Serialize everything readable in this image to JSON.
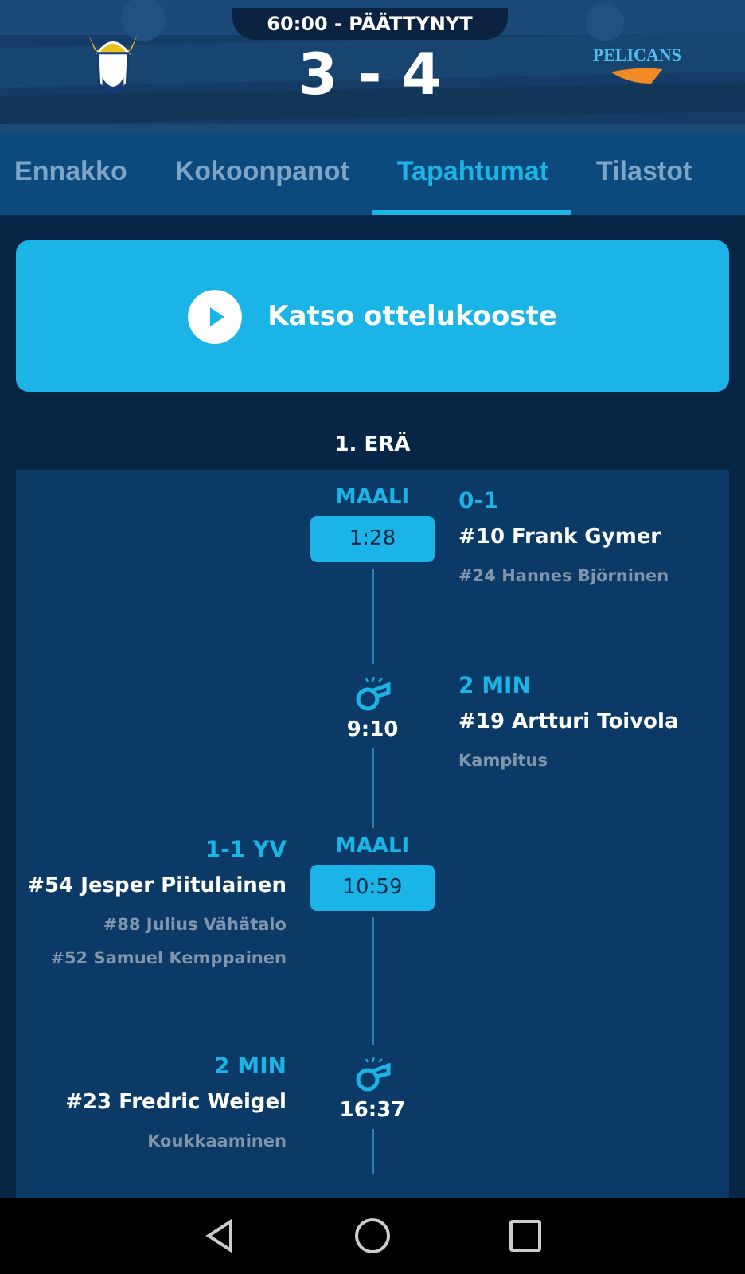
{
  "header": {
    "status": "60:00 - PÄÄTTYNYT",
    "score": "3 - 4",
    "away_logo_text": "PELICANS"
  },
  "tabs": [
    {
      "label": "Ennakko",
      "selected": false
    },
    {
      "label": "Kokoonpanot",
      "selected": false
    },
    {
      "label": "Tapahtumat",
      "selected": true
    },
    {
      "label": "Tilastot",
      "selected": false
    }
  ],
  "highlights_button": {
    "label": "Katso ottelukooste"
  },
  "period": {
    "title": "1. ERÄ"
  },
  "events": [
    {
      "kind": "goal",
      "home_team": false,
      "type_label": "MAALI",
      "time": "1:28",
      "title": "0-1",
      "player": "#10 Frank Gymer",
      "details": [
        "#24 Hannes Björninen"
      ]
    },
    {
      "kind": "penalty",
      "home_team": false,
      "time": "9:10",
      "title": "2 MIN",
      "player": "#19 Artturi Toivola",
      "details": [
        "Kampitus"
      ]
    },
    {
      "kind": "goal",
      "home_team": true,
      "type_label": "MAALI",
      "time": "10:59",
      "title": "1-1 YV",
      "player": "#54 Jesper Piitulainen",
      "details": [
        "#88 Julius Vähätalo",
        "#52 Samuel Kemppainen"
      ]
    },
    {
      "kind": "penalty",
      "home_team": true,
      "time": "16:37",
      "title": "2 MIN",
      "player": "#23 Fredric Weigel",
      "details": [
        "Koukkaaminen"
      ]
    }
  ]
}
